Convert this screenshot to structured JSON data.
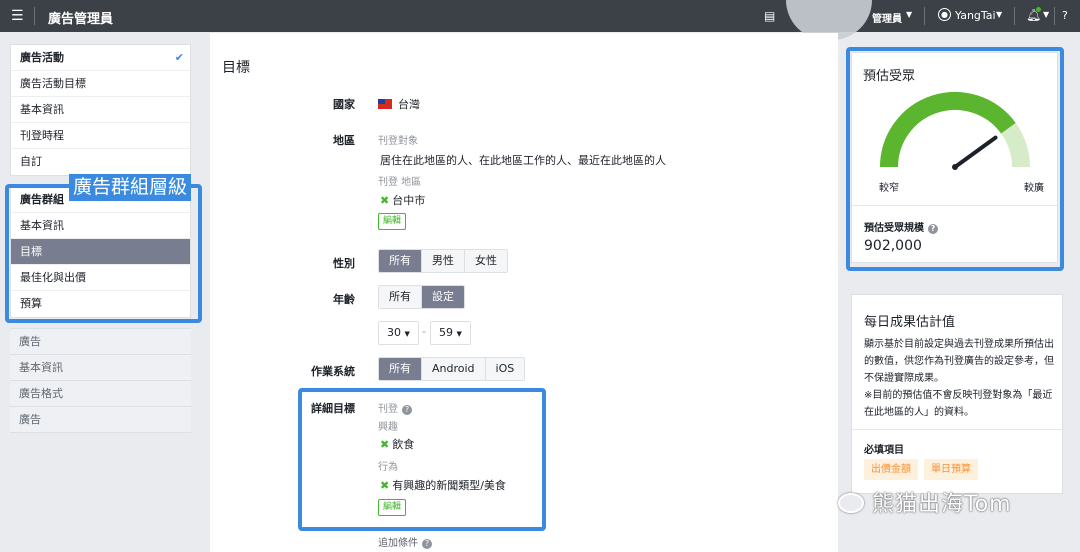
{
  "topbar": {
    "title": "廣告管理員",
    "manager_label": "管理員",
    "user_name": "YangTai"
  },
  "sidebar": {
    "campaign": [
      {
        "label": "廣告活動",
        "checked": true
      },
      {
        "label": "廣告活動目標"
      },
      {
        "label": "基本資訊"
      },
      {
        "label": "刊登時程"
      },
      {
        "label": "自訂"
      }
    ],
    "adset": [
      {
        "label": "廣告群組"
      },
      {
        "label": "基本資訊"
      },
      {
        "label": "目標"
      },
      {
        "label": "最佳化與出價"
      },
      {
        "label": "預算"
      }
    ],
    "ad": [
      {
        "label": "廣告"
      },
      {
        "label": "基本資訊"
      },
      {
        "label": "廣告格式"
      },
      {
        "label": "廣告"
      }
    ],
    "highlight_label": "廣告群組層級"
  },
  "main": {
    "title": "目標",
    "country_label": "國家",
    "country_value": "台灣",
    "region_label": "地區",
    "audience_sub": "刊登對象",
    "audience_value": "居住在此地區的人、在此地區工作的人、最近在此地區的人",
    "region_sub": "刊登 地區",
    "region_value": "台中市",
    "edit_label": "編輯",
    "gender_label": "性別",
    "gender_options": [
      "所有",
      "男性",
      "女性"
    ],
    "age_label": "年齡",
    "age_options": [
      "所有",
      "設定"
    ],
    "age_min": "30",
    "age_max": "59",
    "os_label": "作業系統",
    "os_options": [
      "所有",
      "Android",
      "iOS"
    ],
    "detail_label": "詳細目標",
    "detail_sub": "刊登",
    "interest_sub": "興趣",
    "interest_value": "飲食",
    "behavior_sub": "行為",
    "behavior_value": "有興趣的新聞類型/美食",
    "add_condition": "追加條件"
  },
  "audience": {
    "title": "預估受眾",
    "narrow": "較窄",
    "broad": "較廣",
    "size_label": "預估受眾規模",
    "size_value": "902,000",
    "gauge_level": 0.8
  },
  "daily": {
    "title": "每日成果估計值",
    "description": "顯示基於目前設定與過去刊登成果所預估出的數值，供您作為刊登廣告的設定參考，但不保證實際成果。",
    "note": "※目前的預估值不會反映刊登對象為「最近在此地區的人」的資料。",
    "required_label": "必填項目",
    "tags": [
      "出價金額",
      "單日預算"
    ]
  },
  "watermark": "熊猫出海Tom",
  "colors": {
    "highlight": "#3a8ae0",
    "gauge_green": "#5bb52f",
    "active_bg": "#787d90"
  }
}
